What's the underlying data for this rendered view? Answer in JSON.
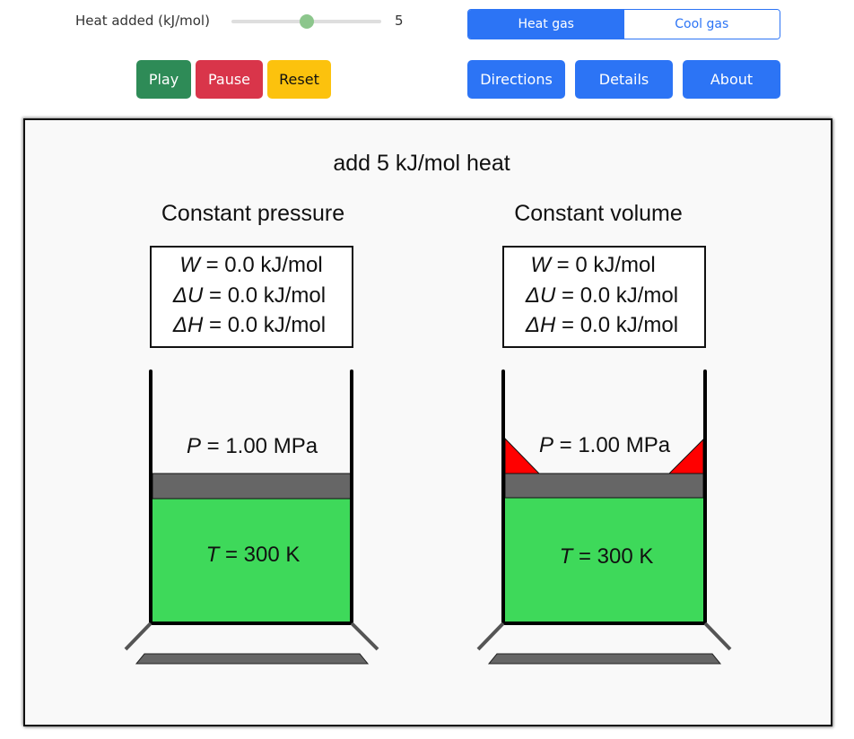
{
  "controls": {
    "slider_label": "Heat added (kJ/mol)",
    "slider_value": "5",
    "slider_min": 0,
    "slider_max": 10,
    "play_label": "Play",
    "pause_label": "Pause",
    "reset_label": "Reset",
    "mode_options": [
      "Heat gas",
      "Cool gas"
    ],
    "mode_selected": "Heat gas",
    "directions_label": "Directions",
    "details_label": "Details",
    "about_label": "About"
  },
  "colors": {
    "primary": "#2c74f5",
    "play": "#2e8b57",
    "pause": "#d9354a",
    "reset": "#fcc20d",
    "gas": "#3ed95a",
    "piston": "#666666",
    "stop": "#ff0000"
  },
  "sim": {
    "title": "add 5 kJ/mol heat",
    "left": {
      "heading": "Constant pressure",
      "w_sym": "W",
      "w_val": " = 0.0 kJ/mol",
      "du_sym": "ΔU",
      "du_val": " = 0.0 kJ/mol",
      "dh_sym": "ΔH",
      "dh_val": " = 0.0 kJ/mol",
      "p_sym": "P",
      "p_val": " = 1.00 MPa",
      "t_sym": "T",
      "t_val": " = 300 K"
    },
    "right": {
      "heading": "Constant volume",
      "w_sym": "W",
      "w_val": " = 0 kJ/mol",
      "du_sym": "ΔU",
      "du_val": " = 0.0 kJ/mol",
      "dh_sym": "ΔH",
      "dh_val": " = 0.0 kJ/mol",
      "p_sym": "P",
      "p_val": " = 1.00 MPa",
      "t_sym": "T",
      "t_val": " = 300 K"
    }
  }
}
